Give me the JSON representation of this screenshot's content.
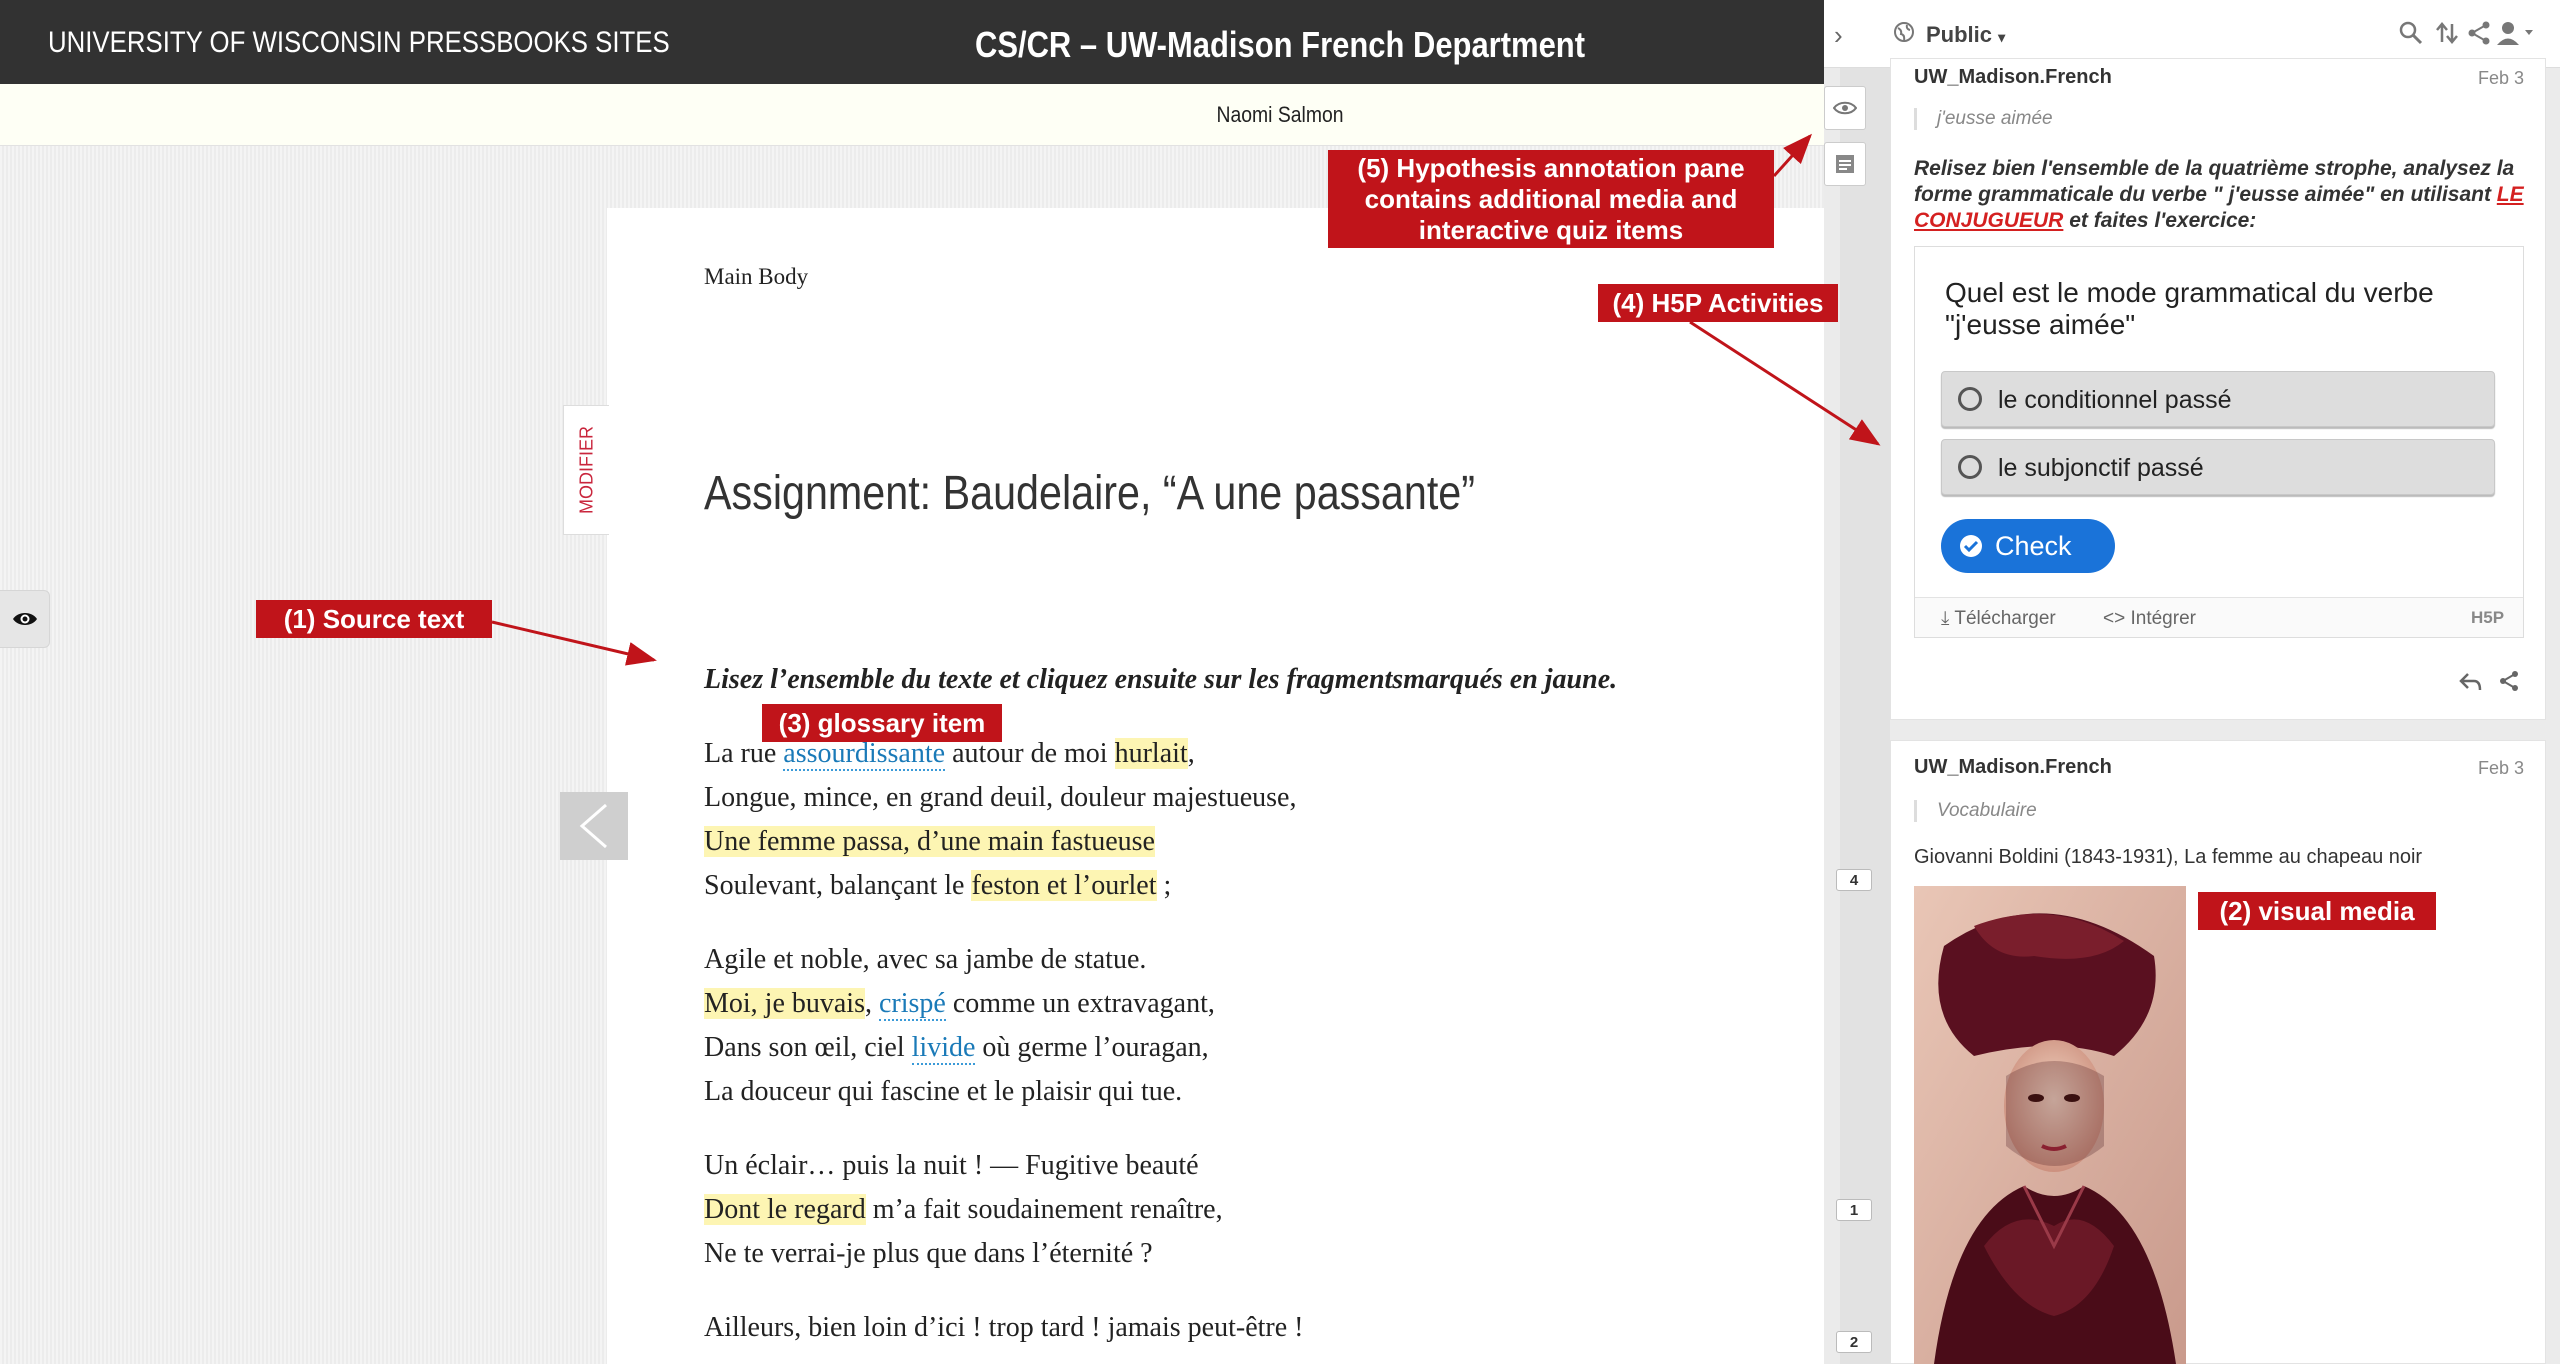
{
  "header": {
    "site_name": "UNIVERSITY OF WISCONSIN PRESSBOOKS SITES",
    "book_title": "CS/CR – UW-Madison French Department",
    "author": "Naomi Salmon"
  },
  "content": {
    "section_label": "Main Body",
    "modifier_label": "MODIFIER",
    "title": "Assignment: Baudelaire, “A une passante”",
    "instructions": "Lisez l’ensemble du texte et cliquez ensuite sur les fragmentsmarqués en jaune.",
    "poem": {
      "l1": {
        "a": "La rue ",
        "g": "assourdissante",
        "b": " autour de moi ",
        "h": "hurlait",
        "c": ","
      },
      "l2": "Longue, mince, en grand deuil, douleur majestueuse,",
      "l3": {
        "h": "Une femme passa, d’une main fastueuse"
      },
      "l4": {
        "a": "Soulevant, balançant le ",
        "h": "feston et l’ourlet",
        "b": " ;"
      },
      "l5": "Agile et noble, avec sa jambe de statue.",
      "l6": {
        "h": "Moi, je buvais",
        "a": ", ",
        "g": "crispé",
        "b": " comme un extravagant,"
      },
      "l7": {
        "a": "Dans son œil, ciel ",
        "g": "livide",
        "b": " où germe l’ouragan,"
      },
      "l8": "La douceur qui fascine et le plaisir qui tue.",
      "l9": "Un éclair… puis la nuit ! — Fugitive beauté",
      "l10": {
        "h": "Dont le regard",
        "b": " m’a fait soudainement renaître,"
      },
      "l11": "Ne te verrai-je plus que dans l’éternité ?",
      "l12": "Ailleurs, bien loin d’ici ! trop tard ! jamais peut-être !"
    }
  },
  "gutter": {
    "badges": [
      "4",
      "1",
      "2"
    ]
  },
  "sidebar": {
    "group": "Public",
    "annotation1": {
      "user": "UW_Madison.French",
      "date": "Feb 3",
      "quote": "j'eusse aimée",
      "body_pre": "Relisez bien l'ensemble de la quatrième strophe, analysez la forme grammaticale du verbe \" j'eusse aimée\" en utilisant ",
      "link": "LE CONJUGUEUR",
      "body_post": " et faites l'exercice:",
      "h5p": {
        "question": "Quel est le mode grammatical du verbe \"j'eusse aimée\"",
        "options": [
          "le conditionnel passé",
          "le subjonctif passé"
        ],
        "check": "Check",
        "download": "Télécharger",
        "embed": "Intégrer",
        "brand": "H5P"
      }
    },
    "annotation2": {
      "user": "UW_Madison.French",
      "date": "Feb 3",
      "quote": "Vocabulaire",
      "caption": "Giovanni Boldini (1843-1931), La femme au chapeau noir"
    }
  },
  "callouts": {
    "source_text": "(1) Source text",
    "visual_media": "(2) visual media",
    "glossary_item": "(3) glossary item",
    "h5p_activities": "(4) H5P Activities",
    "hypothesis": "(5) Hypothesis annotation pane contains additional media and interactive quiz items"
  },
  "colors": {
    "highlight": "#fdf5b3",
    "callout": "#c0141a",
    "check_button": "#1a73d9",
    "link": "#d42020"
  }
}
